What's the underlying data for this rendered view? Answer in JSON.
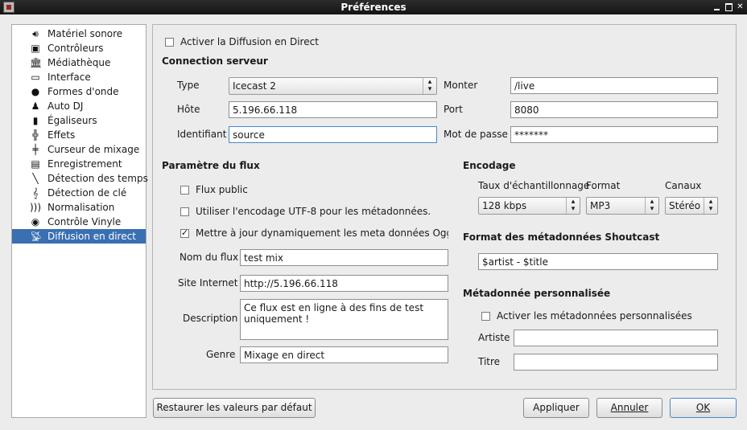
{
  "window": {
    "title": "Préférences"
  },
  "sidebar": {
    "items": [
      {
        "label": "Matériel sonore",
        "icon": "speaker-icon"
      },
      {
        "label": "Contrôleurs",
        "icon": "controller-icon"
      },
      {
        "label": "Médiathèque",
        "icon": "library-icon"
      },
      {
        "label": "Interface",
        "icon": "monitor-icon"
      },
      {
        "label": "Formes d'onde",
        "icon": "waveform-icon"
      },
      {
        "label": "Auto DJ",
        "icon": "robot-icon"
      },
      {
        "label": "Égaliseurs",
        "icon": "equalizer-icon"
      },
      {
        "label": "Effets",
        "icon": "effects-icon"
      },
      {
        "label": "Curseur de mixage",
        "icon": "crossfader-icon"
      },
      {
        "label": "Enregistrement",
        "icon": "recording-icon"
      },
      {
        "label": "Détection des temps",
        "icon": "metronome-icon"
      },
      {
        "label": "Détection de clé",
        "icon": "key-icon"
      },
      {
        "label": "Normalisation",
        "icon": "normalization-icon"
      },
      {
        "label": "Contrôle Vinyle",
        "icon": "vinyl-icon"
      },
      {
        "label": "Diffusion en direct",
        "icon": "broadcast-icon"
      }
    ],
    "selected": "Diffusion en direct",
    "selection_color": "#3a6fb2"
  },
  "broadcast": {
    "enable_label": "Activer la Diffusion en Direct",
    "enable_checked": false
  },
  "connection": {
    "heading": "Connection serveur",
    "type_label": "Type",
    "type_value": "Icecast 2",
    "mount_label": "Monter",
    "mount_value": "/live",
    "host_label": "Hôte",
    "host_value": "5.196.66.118",
    "port_label": "Port",
    "port_value": "8080",
    "login_label": "Identifiant",
    "login_value": "source",
    "password_label": "Mot de passe",
    "password_value": "*******"
  },
  "stream": {
    "heading": "Paramètre du flux",
    "public_label": "Flux public",
    "public_checked": false,
    "utf8_label": "Utiliser l'encodage UTF-8 pour les métadonnées.",
    "utf8_checked": false,
    "dynamic_label": "Mettre à jour dynamiquement les meta données Ogg Vo",
    "dynamic_checked": true,
    "name_label": "Nom du flux",
    "name_value": "test mix",
    "website_label": "Site Internet",
    "website_value": "http://5.196.66.118",
    "description_label": "Description",
    "description_value": "Ce flux est en ligne à des fins de test\nuniquement !",
    "genre_label": "Genre",
    "genre_value": "Mixage en direct"
  },
  "encoding": {
    "heading": "Encodage",
    "bitrate_label": "Taux d'échantillonnage",
    "bitrate_value": "128 kbps",
    "format_label": "Format",
    "format_value": "MP3",
    "channels_label": "Canaux",
    "channels_value": "Stéréo"
  },
  "shoutcast": {
    "heading": "Format des métadonnées Shoutcast",
    "value": "$artist - $title"
  },
  "custom_meta": {
    "heading": "Métadonnée personnalisée",
    "enable_label": "Activer les métadonnées personnalisées",
    "enable_checked": false,
    "artist_label": "Artiste",
    "artist_value": "",
    "title_label": "Titre",
    "title_value": ""
  },
  "footer": {
    "reset_label": "Restaurer les valeurs par défaut",
    "apply_label": "Appliquer",
    "cancel_label": "Annuler",
    "ok_label": "OK"
  }
}
